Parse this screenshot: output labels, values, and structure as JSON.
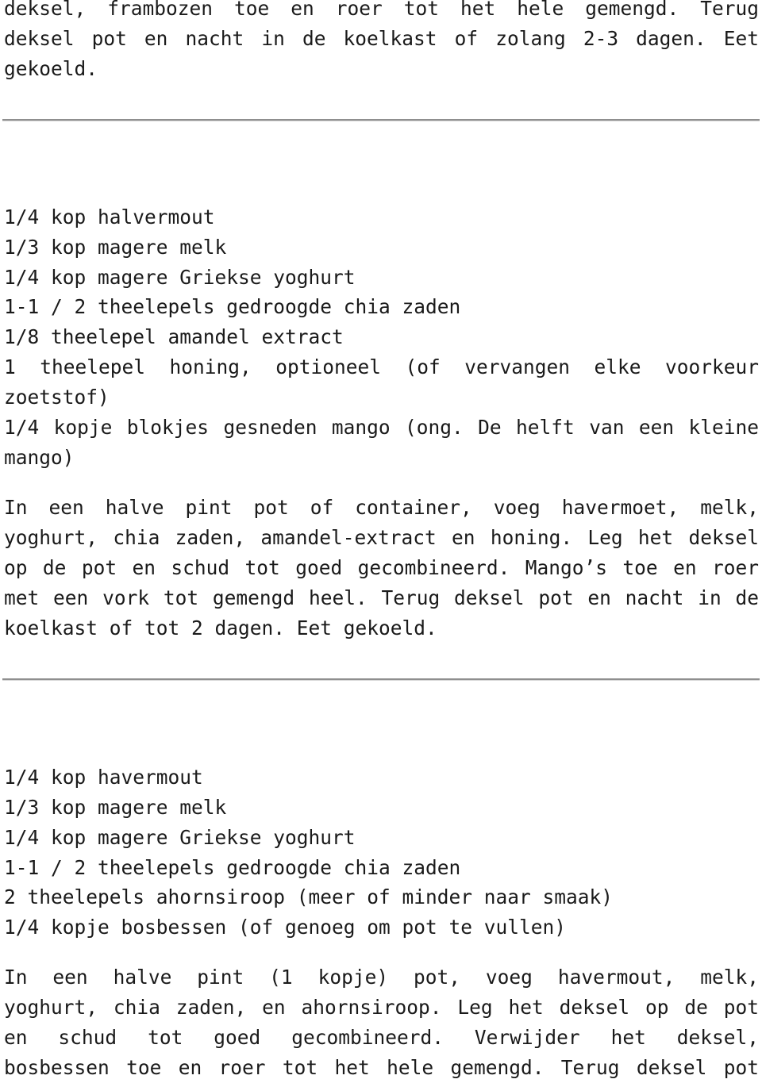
{
  "top_fragment": {
    "lines": [
      "deksel, frambozen toe en roer tot het hele gemengd. Terug",
      "deksel pot en nacht in de koelkast of zolang 2-3 dagen. Eet",
      "gekoeld."
    ]
  },
  "recipe_mango": {
    "ingredients": [
      "1/4 kop halvermout",
      "1/3 kop magere melk",
      "1/4 kop magere Griekse yoghurt",
      "1-1 / 2 theelepels gedroogde chia zaden",
      "1/8 theelepel amandel extract",
      "1 theelepel honing, optioneel (of vervangen elke voorkeur",
      "zoetstof)",
      "1/4 kopje blokjes gesneden mango (ong. De helft van een kleine",
      "mango)"
    ],
    "instructions": [
      "In een halve pint pot of container, voeg havermoet, melk,",
      "yoghurt, chia zaden, amandel-extract en honing. Leg het deksel",
      "op de pot en schud tot goed gecombineerd. Mango’s toe en roer",
      "met een vork tot gemengd heel. Terug deksel pot en nacht in de",
      "koelkast of tot 2 dagen. Eet gekoeld."
    ]
  },
  "recipe_blueberry": {
    "ingredients": [
      "1/4 kop havermout",
      "1/3 kop magere melk",
      "1/4 kop magere Griekse yoghurt",
      "1-1 / 2 theelepels gedroogde chia zaden",
      "2 theelepels ahornsiroop (meer of minder naar smaak)",
      "1/4 kopje bosbessen (of genoeg om pot te vullen)"
    ],
    "instructions": [
      "In een halve pint (1 kopje) pot, voeg havermout, melk,",
      "yoghurt, chia zaden, en ahornsiroop. Leg het deksel op de pot",
      "en schud tot goed gecombineerd. Verwijder het deksel,",
      "bosbessen toe en roer tot het hele gemengd. Terug deksel pot"
    ]
  },
  "colors": {
    "text": "#1a1a1a",
    "rule": "#8f8f8f",
    "background": "#ffffff"
  }
}
